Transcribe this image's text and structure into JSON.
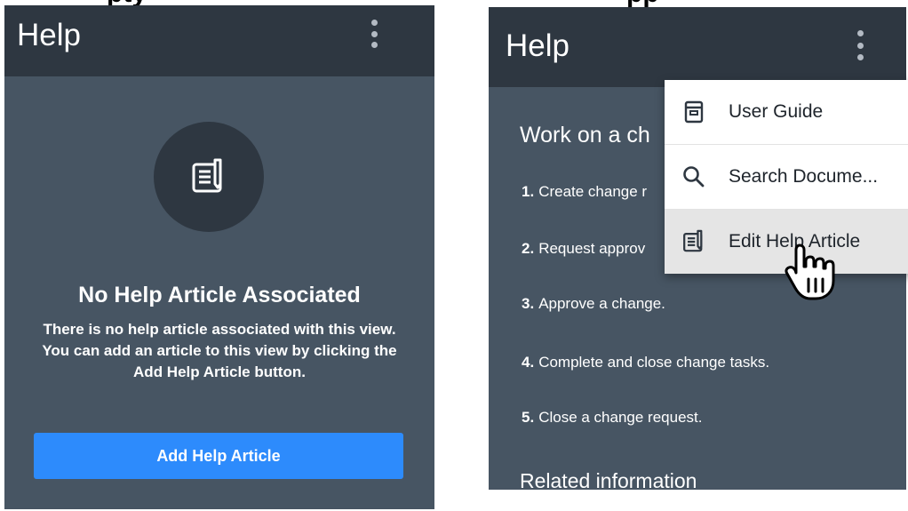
{
  "captions": {
    "left_partial": "pty",
    "right_partial": "pp"
  },
  "left_panel": {
    "header_title": "Help",
    "empty_title": "No Help Article Associated",
    "empty_description": "There is no help article associated with this view. You can add an article to this view by clicking the Add Help Article button.",
    "add_button_label": "Add Help Article"
  },
  "right_panel": {
    "header_title": "Help",
    "article_heading": "Work on a ch",
    "steps": [
      {
        "num": "1.",
        "text": "Create change r"
      },
      {
        "num": "2.",
        "text": "Request approv"
      },
      {
        "num": "3.",
        "text": "Approve a change."
      },
      {
        "num": "4.",
        "text": "Complete and close change tasks."
      },
      {
        "num": "5.",
        "text": "Close a change request."
      }
    ],
    "related_heading": "Related information"
  },
  "menu": {
    "items": [
      {
        "label": "User Guide",
        "icon": "book-icon"
      },
      {
        "label": "Search Docume...",
        "icon": "search-icon"
      },
      {
        "label": "Edit Help Article",
        "icon": "edit-article-icon"
      }
    ]
  },
  "colors": {
    "panel_bg": "#475563",
    "header_bg": "#2e3741",
    "button_bg": "#2d8bfc",
    "menu_hover_bg": "#e5e5e5"
  }
}
